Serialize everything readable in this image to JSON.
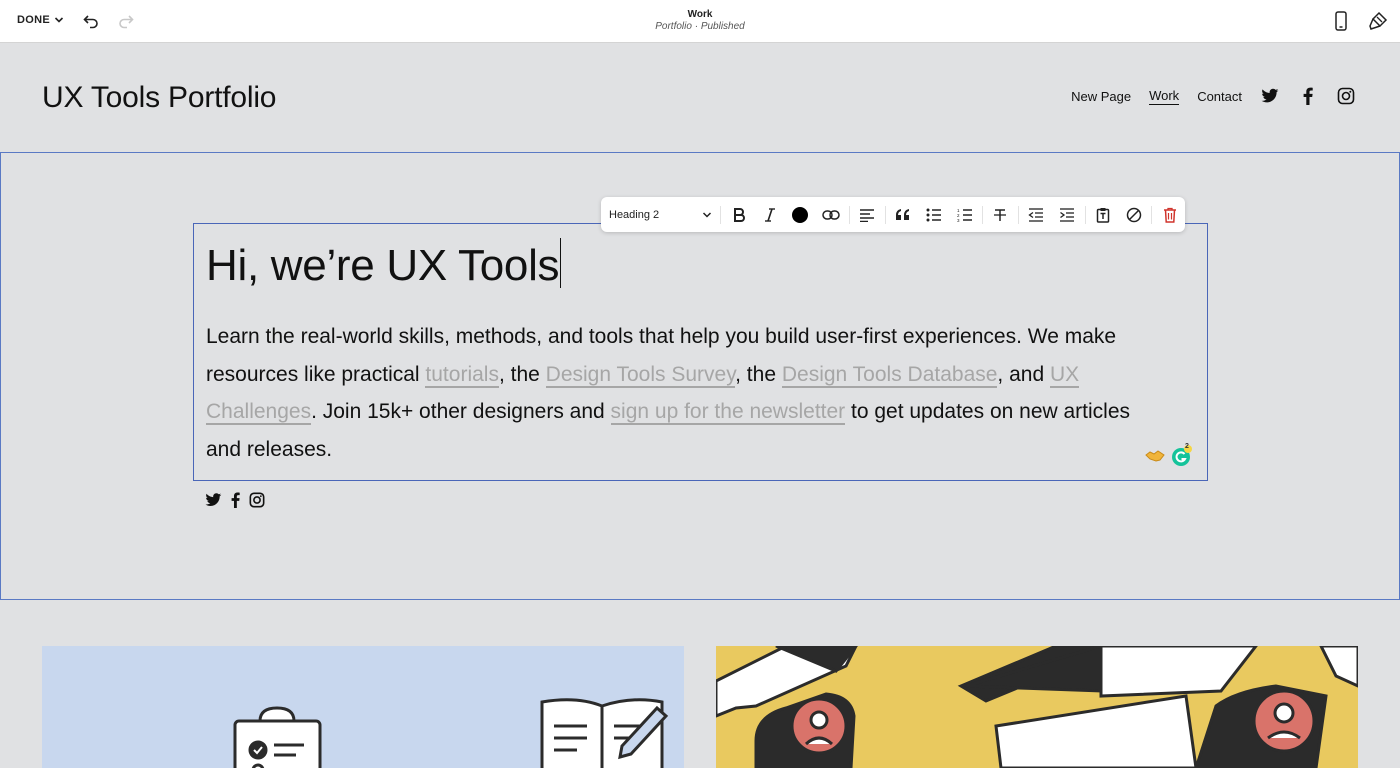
{
  "topbar": {
    "done_label": "DONE",
    "page_title": "Work",
    "page_subtitle": "Portfolio · Published"
  },
  "site": {
    "title": "UX Tools Portfolio",
    "nav": [
      "New Page",
      "Work",
      "Contact"
    ],
    "active_nav": "Work"
  },
  "toolbar": {
    "style_value": "Heading 2",
    "text_color": "#000000",
    "buttons": [
      "bold",
      "italic",
      "text-color",
      "link",
      "align-left",
      "quote",
      "bullet-list",
      "numbered-list",
      "strikethrough",
      "outdent",
      "indent",
      "paste-plain",
      "clear-format",
      "delete"
    ]
  },
  "content": {
    "heading": "Hi, we’re UX Tools",
    "p1": "Learn the real-world skills, methods, and tools that help you build user-first experiences. We make resources like practical ",
    "link1": "tutorials",
    "p2": ", the ",
    "link2": "Design Tools Survey",
    "p3": ", the ",
    "link3": "Design Tools Database",
    "p4": ", and ",
    "link4": "UX Challenges",
    "p5": ". Join 15k+ other designers and ",
    "link5": "sign up for the newsletter",
    "p6": " to get updates on new articles and releases.",
    "grammarly_count": "2"
  },
  "colors": {
    "accent_outline": "#4a66b8",
    "link_grey": "#a6a6a6",
    "delete_red": "#d0342c",
    "page_bg": "#e0e1e3"
  }
}
